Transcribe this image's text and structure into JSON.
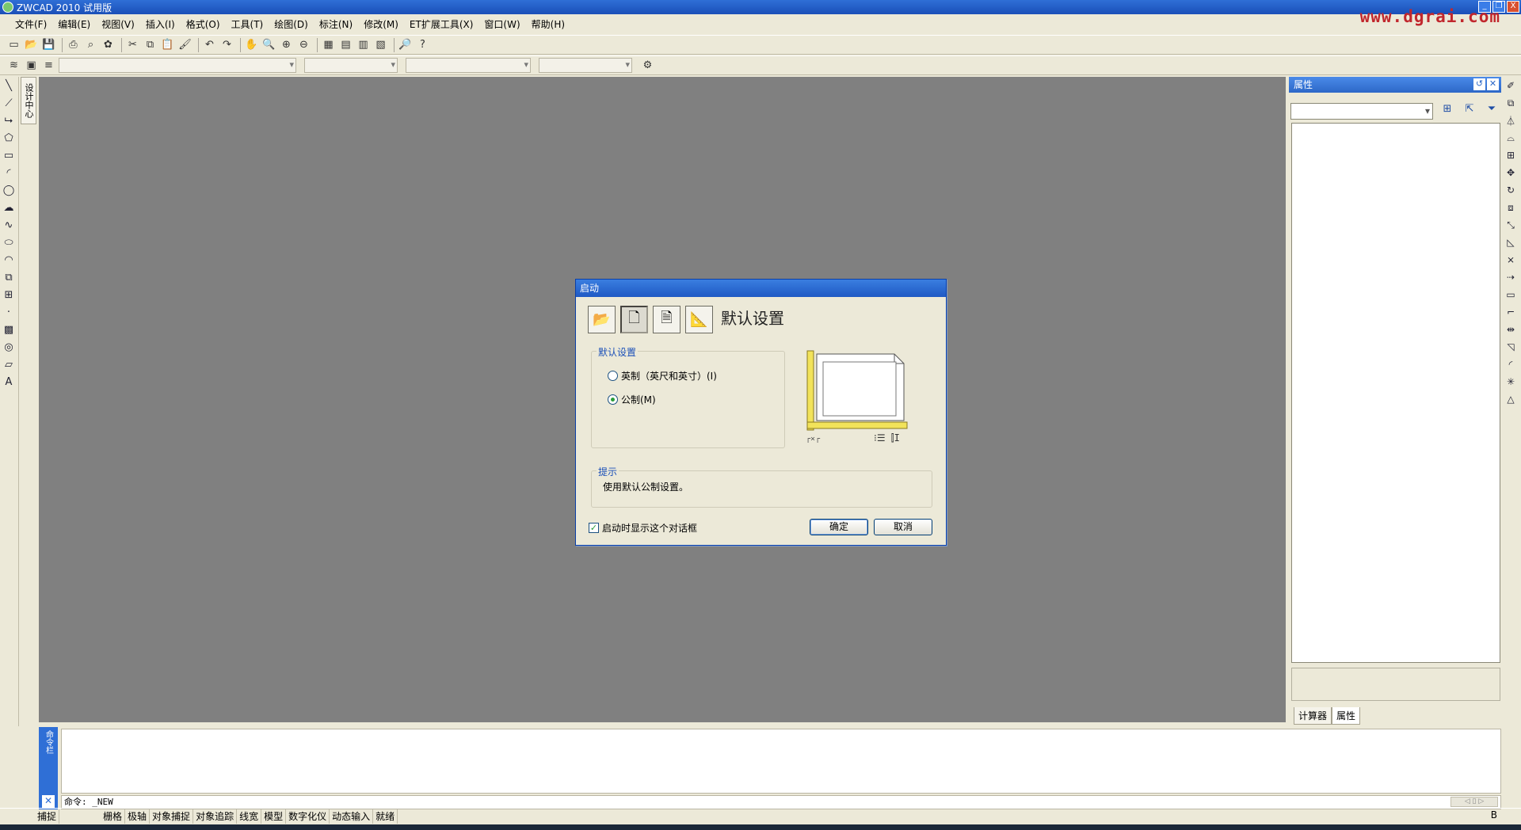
{
  "window": {
    "title": "ZWCAD 2010 试用版",
    "watermark": "www.dgrai.com",
    "controls": [
      "_",
      "❐",
      "X"
    ]
  },
  "menu": [
    "文件(F)",
    "编辑(E)",
    "视图(V)",
    "插入(I)",
    "格式(O)",
    "工具(T)",
    "绘图(D)",
    "标注(N)",
    "修改(M)",
    "ET扩展工具(X)",
    "窗口(W)",
    "帮助(H)"
  ],
  "toolbar1_icons": [
    "new-icon",
    "open-icon",
    "save-icon",
    "print-icon",
    "print-preview-icon",
    "publish-icon",
    "cut-icon",
    "copy-icon",
    "paste-icon",
    "match-properties-icon",
    "undo-icon",
    "redo-icon",
    "pan-icon",
    "zoom-realtime-icon",
    "zoom-window-icon",
    "zoom-previous-icon",
    "properties-icon",
    "design-center-icon",
    "tool-palettes-icon",
    "calculator-icon",
    "find-icon",
    "help-icon"
  ],
  "design_center_tab": "设计中心",
  "properties_panel": {
    "title": "属性",
    "tabs": [
      "计算器",
      "属性"
    ],
    "active_tab": "属性"
  },
  "command": {
    "side_label": "命令栏",
    "prompt": "命令: _NEW",
    "scroll": "◁ ▯ ▷"
  },
  "statusbar": {
    "items": [
      "捕捉",
      "栅格",
      "极轴",
      "对象捕捉",
      "对象追踪",
      "线宽",
      "模型",
      "数字化仪",
      "动态输入",
      "就绪"
    ],
    "right_text": "B"
  },
  "dialog": {
    "title": "启动",
    "heading": "默认设置",
    "group_label": "默认设置",
    "options": [
      {
        "label": "英制（英尺和英寸）(I)",
        "selected": false
      },
      {
        "label": "公制(M)",
        "selected": true
      }
    ],
    "preview_labels": {
      "left": "┌×┌",
      "right": "⁝☰ ⫿I"
    },
    "tip_label": "提示",
    "tip_text": "使用默认公制设置。",
    "show_on_startup_label": "启动时显示这个对话框",
    "show_on_startup": true,
    "ok_label": "确定",
    "cancel_label": "取消"
  }
}
